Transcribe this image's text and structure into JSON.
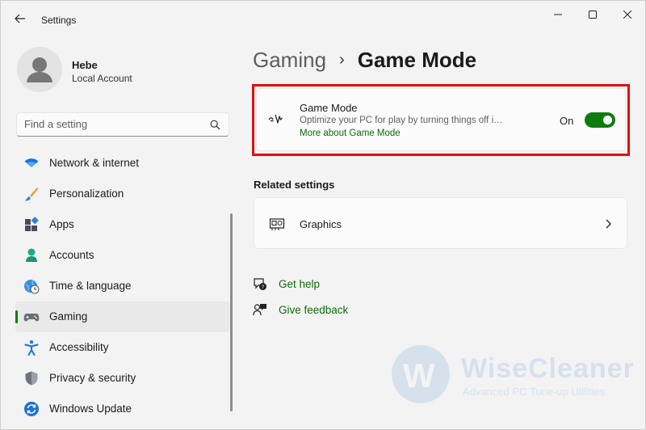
{
  "window": {
    "title": "Settings"
  },
  "profile": {
    "name": "Hebe",
    "account_type": "Local Account"
  },
  "search": {
    "placeholder": "Find a setting"
  },
  "nav": {
    "items": [
      {
        "label": "Network & internet",
        "icon": "wifi-icon"
      },
      {
        "label": "Personalization",
        "icon": "brush-icon"
      },
      {
        "label": "Apps",
        "icon": "apps-icon"
      },
      {
        "label": "Accounts",
        "icon": "person-icon"
      },
      {
        "label": "Time & language",
        "icon": "globe-clock-icon"
      },
      {
        "label": "Gaming",
        "icon": "controller-icon",
        "active": true
      },
      {
        "label": "Accessibility",
        "icon": "accessibility-icon"
      },
      {
        "label": "Privacy & security",
        "icon": "shield-icon"
      },
      {
        "label": "Windows Update",
        "icon": "update-icon"
      }
    ]
  },
  "breadcrumb": {
    "parent": "Gaming",
    "separator": "›",
    "current": "Game Mode"
  },
  "game_mode": {
    "title": "Game Mode",
    "description": "Optimize your PC for play by turning things off in the background",
    "link": "More about Game Mode",
    "state_label": "On",
    "enabled": true
  },
  "related": {
    "heading": "Related settings",
    "graphics_label": "Graphics"
  },
  "help": {
    "get_help": "Get help",
    "give_feedback": "Give feedback"
  },
  "watermark": {
    "letter": "W",
    "brand": "WiseCleaner",
    "tagline": "Advanced PC Tune-up Utilities"
  },
  "colors": {
    "accent": "#0f7b0f",
    "link": "#0c6b0c",
    "highlight_border": "#e01010",
    "background": "#f3f3f3"
  }
}
